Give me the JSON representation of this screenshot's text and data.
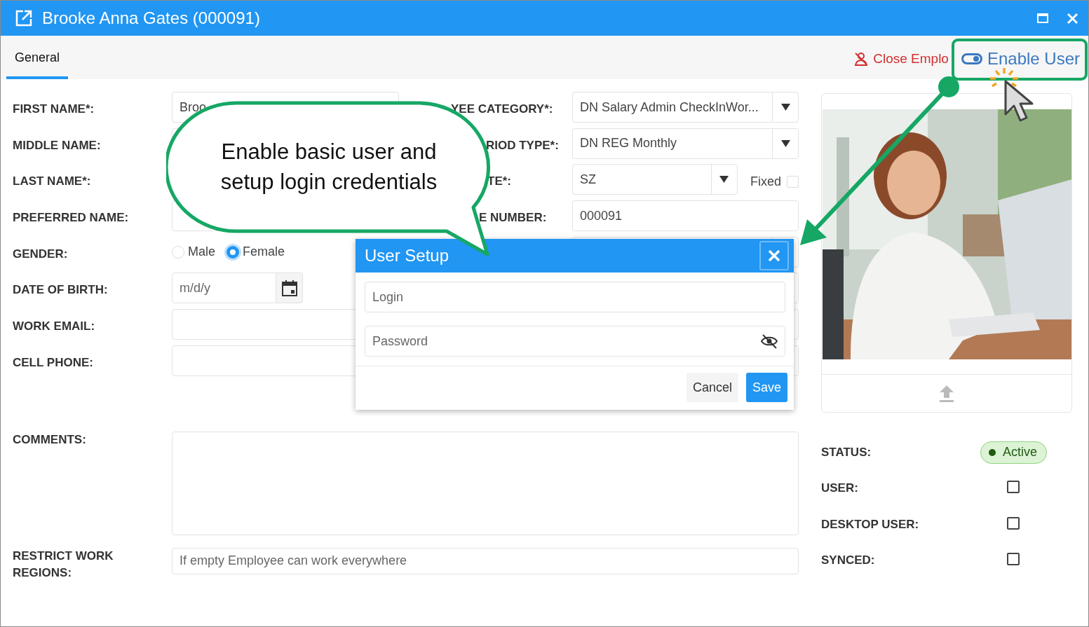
{
  "window": {
    "title": "Brooke Anna Gates (000091)"
  },
  "tabs": [
    {
      "label": "General",
      "selected": true
    }
  ],
  "actions": [
    {
      "kind": "close_employee",
      "label": "Close Emplo"
    },
    {
      "kind": "enable_user",
      "label": "Enable User"
    }
  ],
  "left_fields": [
    {
      "label": "FIRST NAME*:",
      "kind": "text",
      "value": "Broo"
    },
    {
      "label": "MIDDLE NAME:",
      "kind": "text"
    },
    {
      "label": "LAST NAME*:"
    },
    {
      "label": "PREFERRED NAME:",
      "kind": "text"
    },
    {
      "label": "GENDER:",
      "kind": "radio",
      "options": [
        {
          "label": "Male",
          "selected": false
        },
        {
          "label": "Female",
          "selected": true
        }
      ]
    },
    {
      "label": "DATE OF BIRTH:",
      "kind": "date",
      "placeholder": "m/d/y"
    },
    {
      "label": "WORK EMAIL:",
      "kind": "text"
    },
    {
      "label": "CELL PHONE:",
      "kind": "text"
    }
  ],
  "right_fields": [
    {
      "label": "YEE CATEGORY*:",
      "kind": "select",
      "value": "DN Salary Admin CheckInWor..."
    },
    {
      "label": "RIOD TYPE*:",
      "kind": "select",
      "value": "DN REG Monthly"
    },
    {
      "label": "TE*:",
      "kind": "select",
      "value": "SZ",
      "fixed": {
        "label": "Fixed",
        "checked": false
      }
    },
    {
      "label": "E NUMBER:",
      "kind": "text",
      "value": "000091"
    },
    {
      "kind": "select"
    },
    {
      "kind": "text"
    },
    {
      "kind": "text"
    },
    {
      "kind": "text"
    }
  ],
  "comments": {
    "label": "COMMENTS:"
  },
  "restrict_regions": {
    "label": "RESTRICT WORK REGIONS:",
    "placeholder": "If empty Employee can work everywhere"
  },
  "status": {
    "label": "STATUS:",
    "value": "Active"
  },
  "flags": [
    {
      "label": "USER:",
      "checked": false
    },
    {
      "label": "DESKTOP USER:",
      "checked": false
    },
    {
      "label": "SYNCED:",
      "checked": false
    }
  ],
  "dialog": {
    "title": "User Setup",
    "fields": [
      {
        "kind": "text",
        "placeholder": "Login"
      },
      {
        "kind": "password",
        "placeholder": "Password"
      }
    ],
    "buttons": [
      {
        "kind": "secondary",
        "label": "Cancel"
      },
      {
        "kind": "primary",
        "label": "Save"
      }
    ]
  },
  "callout": {
    "text": "Enable basic user and setup login credentials"
  }
}
